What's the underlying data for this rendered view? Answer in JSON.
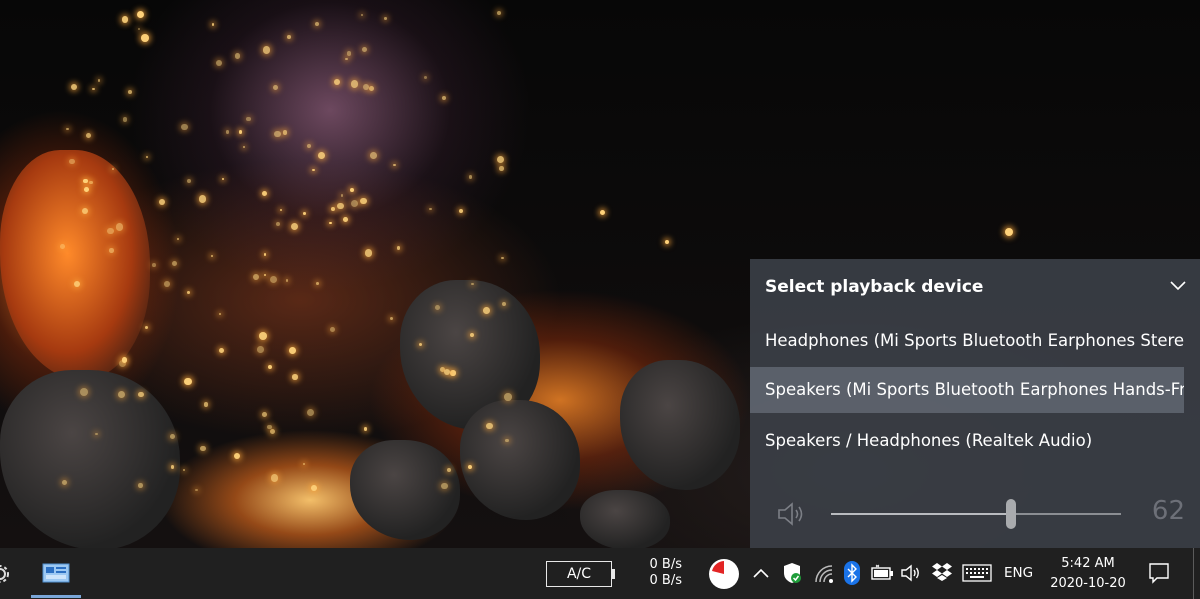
{
  "flyout": {
    "title": "Select playback device",
    "devices": [
      {
        "label": "Headphones (Mi Sports Bluetooth Earphones Stereo)",
        "selected": false
      },
      {
        "label": "Speakers (Mi Sports Bluetooth Earphones Hands-Free)",
        "selected": true
      },
      {
        "label": "Speakers / Headphones (Realtek Audio)",
        "selected": false
      }
    ],
    "volume": {
      "value": "62",
      "level": 0.62,
      "icon": "speaker-icon"
    }
  },
  "taskbar": {
    "power_label": "A/C",
    "net_up": "0 B/s",
    "net_down": "0 B/s",
    "language": "ENG",
    "time": "5:42 AM",
    "date": "2020-10-20",
    "tray_icons": [
      "pie-timer-icon",
      "chevron-up-icon",
      "shield-icon",
      "wifi-icon",
      "bluetooth-icon",
      "battery-icon",
      "speaker-icon",
      "dropbox-icon",
      "keyboard-icon",
      "notification-icon"
    ]
  },
  "colors": {
    "flyout_bg": "#3a3e46",
    "selected_bg": "#787f8c",
    "taskbar_bg": "#202020",
    "accent": "#7aa6d8"
  }
}
